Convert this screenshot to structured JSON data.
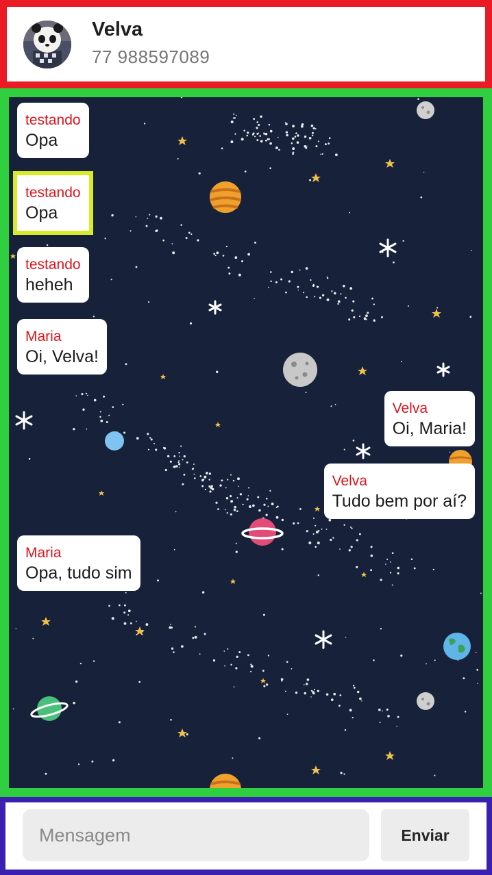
{
  "header": {
    "name": "Velva",
    "phone": "77 988597089",
    "avatar_icon": "panda-avatar-icon"
  },
  "messages": [
    {
      "sender": "testando",
      "text": "Opa",
      "side": "left"
    },
    {
      "sender": "testando",
      "text": "Opa",
      "side": "left",
      "highlighted": true
    },
    {
      "sender": "testando",
      "text": "heheh",
      "side": "left"
    },
    {
      "sender": "Maria",
      "text": "Oi, Velva!",
      "side": "left"
    },
    {
      "sender": "Velva",
      "text": "Oi, Maria!",
      "side": "right"
    },
    {
      "sender": "Velva",
      "text": "Tudo bem por aí?",
      "side": "right"
    },
    {
      "sender": "Maria",
      "text": "Opa, tudo sim",
      "side": "left"
    }
  ],
  "composer": {
    "placeholder": "Mensagem",
    "value": "",
    "send_label": "Enviar"
  },
  "colors": {
    "header_border": "#ea1b24",
    "chat_border": "#2fcf3f",
    "footer_border": "#3a1fb0",
    "highlight": "#d8ea2c",
    "space_bg": "#17223a",
    "sender_name": "#e0141c"
  }
}
